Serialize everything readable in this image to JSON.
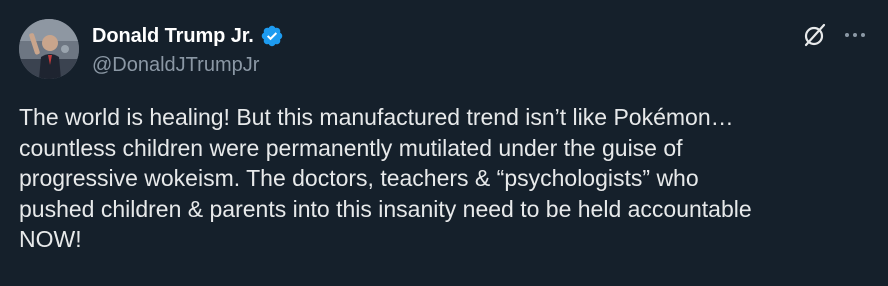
{
  "author": {
    "display_name": "Donald Trump Jr.",
    "handle": "@DonaldJTrumpJr",
    "verified": true,
    "verified_icon": "verified-badge-icon",
    "verified_color": "#1d9bf0"
  },
  "actions": {
    "grok_icon": "grok-icon",
    "more_icon": "more-options-icon"
  },
  "post": {
    "text": "The world is healing! But this manufactured trend isn’t like Pokémon…\ncountless children were permanently mutilated under the guise of\nprogressive wokeism. The doctors, teachers & “psychologists” who\npushed children & parents into this insanity need to be held accountable\nNOW!"
  },
  "colors": {
    "background": "#15202b",
    "text_primary": "#ffffff",
    "text_secondary": "#8b98a5",
    "accent": "#1d9bf0"
  }
}
